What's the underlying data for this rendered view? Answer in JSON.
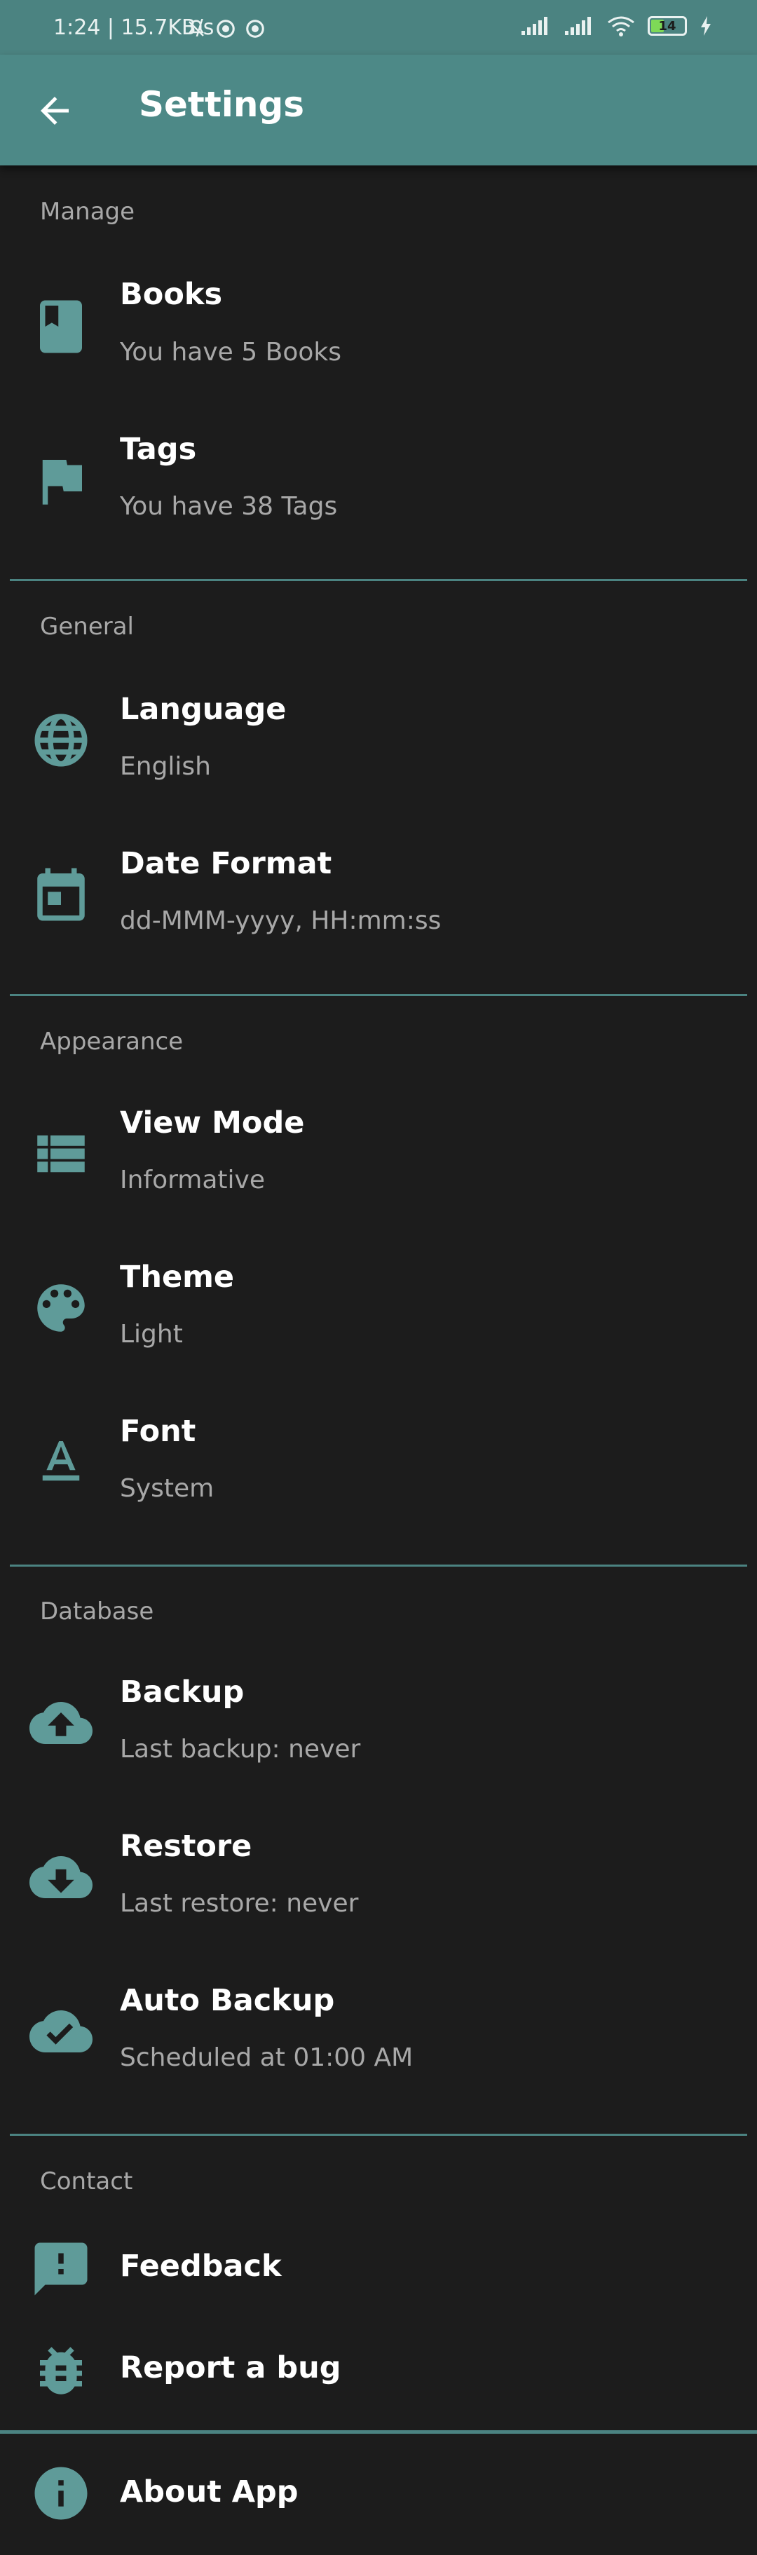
{
  "status_bar": {
    "time_speed": "1:24 | 15.7KB/s",
    "battery": "14"
  },
  "app_bar": {
    "title": "Settings"
  },
  "sections": {
    "manage": {
      "header": "Manage",
      "books": {
        "title": "Books",
        "subtitle": "You have 5 Books"
      },
      "tags": {
        "title": "Tags",
        "subtitle": "You have 38 Tags"
      }
    },
    "general": {
      "header": "General",
      "language": {
        "title": "Language",
        "subtitle": "English"
      },
      "date_format": {
        "title": "Date Format",
        "subtitle": "dd-MMM-yyyy, HH:mm:ss"
      }
    },
    "appearance": {
      "header": "Appearance",
      "view_mode": {
        "title": "View Mode",
        "subtitle": "Informative"
      },
      "theme": {
        "title": "Theme",
        "subtitle": "Light"
      },
      "font": {
        "title": "Font",
        "subtitle": "System"
      }
    },
    "database": {
      "header": "Database",
      "backup": {
        "title": "Backup",
        "subtitle": "Last backup: never"
      },
      "restore": {
        "title": "Restore",
        "subtitle": "Last restore: never"
      },
      "auto_backup": {
        "title": "Auto Backup",
        "subtitle": "Scheduled at 01:00 AM"
      }
    },
    "contact": {
      "header": "Contact",
      "feedback": {
        "title": "Feedback"
      },
      "report_bug": {
        "title": "Report a bug"
      }
    },
    "about": {
      "title": "About App"
    }
  },
  "colors": {
    "accent": "#5f9b99",
    "app_bar": "#4d8987",
    "background": "#1c1c1c",
    "secondary_text": "#a8a8a8"
  }
}
